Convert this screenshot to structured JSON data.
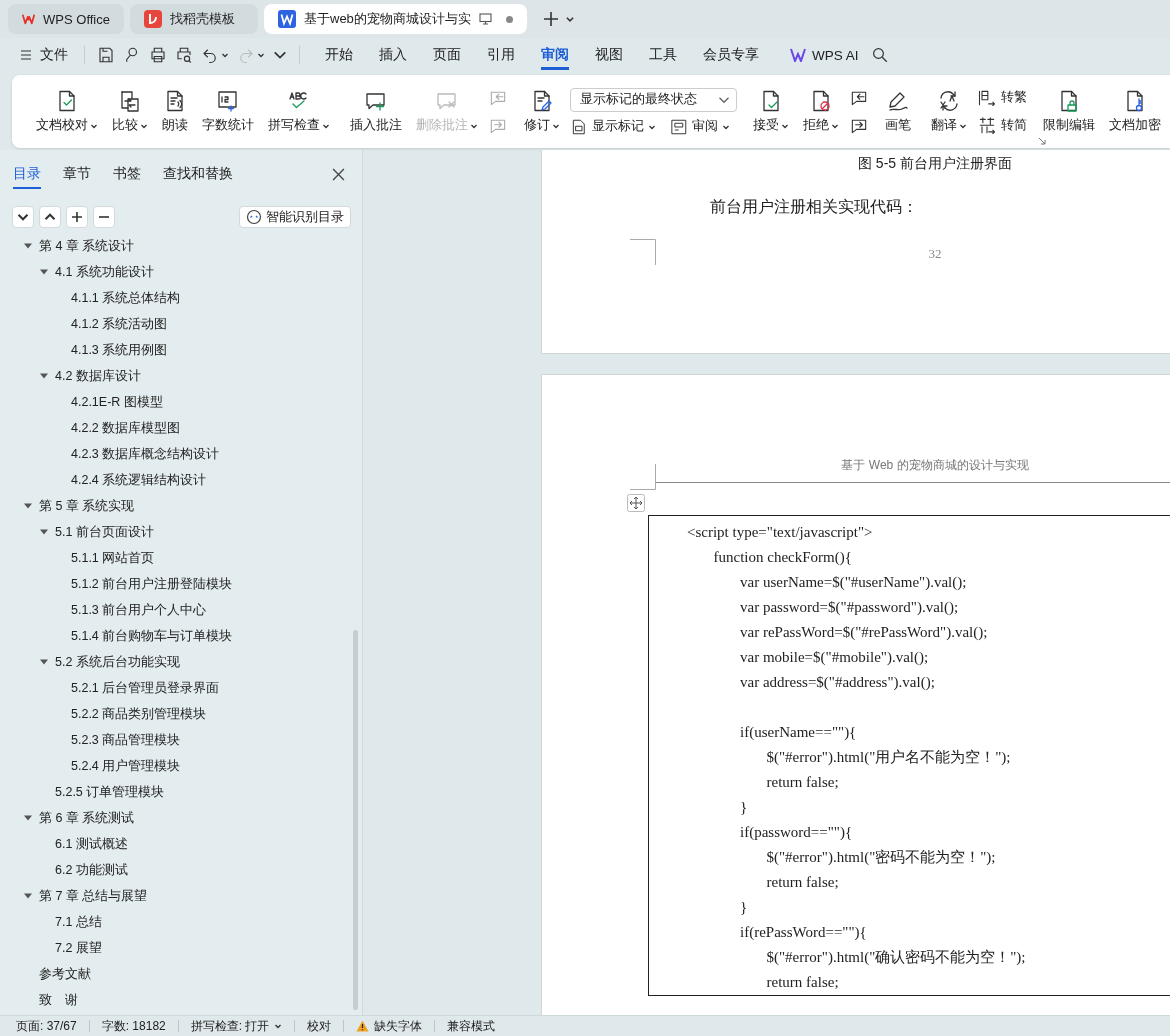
{
  "window_tabs": [
    {
      "label": "WPS Office",
      "kind": "home",
      "selected": false
    },
    {
      "label": "找稻壳模板",
      "kind": "template",
      "selected": false
    },
    {
      "label": "基于web的宠物商城设计与实",
      "kind": "document",
      "selected": true
    }
  ],
  "menu": {
    "file": "文件",
    "tabs": [
      {
        "label": "开始",
        "selected": false
      },
      {
        "label": "插入",
        "selected": false
      },
      {
        "label": "页面",
        "selected": false
      },
      {
        "label": "引用",
        "selected": false
      },
      {
        "label": "审阅",
        "selected": true
      },
      {
        "label": "视图",
        "selected": false
      },
      {
        "label": "工具",
        "selected": false
      },
      {
        "label": "会员专享",
        "selected": false
      }
    ],
    "ai": "WPS AI"
  },
  "ribbon": {
    "groups": [
      {
        "items": [
          {
            "kind": "large",
            "label": "文档校对",
            "dropdown": true,
            "disabled": false
          },
          {
            "kind": "large",
            "label": "比较",
            "dropdown": true,
            "disabled": false
          },
          {
            "kind": "large",
            "label": "朗读",
            "dropdown": false,
            "disabled": false
          },
          {
            "kind": "large",
            "label": "字数统计",
            "dropdown": false,
            "disabled": false
          },
          {
            "kind": "large",
            "label": "拼写检查",
            "dropdown": true,
            "disabled": false
          }
        ]
      },
      {
        "items": [
          {
            "kind": "large",
            "label": "插入批注",
            "dropdown": false,
            "disabled": false
          },
          {
            "kind": "large",
            "label": "删除批注",
            "dropdown": true,
            "disabled": true
          },
          {
            "kind": "pair",
            "disabled": true
          }
        ]
      },
      {
        "items": [
          {
            "kind": "large",
            "label": "修订",
            "dropdown": true,
            "disabled": false
          },
          {
            "kind": "select-stack",
            "select": {
              "value": "显示标记的最终状态"
            },
            "buttons": [
              {
                "label": "显示标记",
                "dropdown": true
              },
              {
                "label": "审阅",
                "dropdown": true
              }
            ]
          }
        ]
      },
      {
        "items": [
          {
            "kind": "large",
            "label": "接受",
            "dropdown": true,
            "disabled": false
          },
          {
            "kind": "large",
            "label": "拒绝",
            "dropdown": true,
            "disabled": false
          },
          {
            "kind": "pair",
            "disabled": false
          }
        ]
      },
      {
        "items": [
          {
            "kind": "large",
            "label": "画笔",
            "dropdown": false,
            "disabled": false
          }
        ]
      },
      {
        "items": [
          {
            "kind": "large",
            "label": "翻译",
            "dropdown": true,
            "disabled": false
          },
          {
            "kind": "small-stack",
            "buttons": [
              {
                "label": "转繁",
                "dropdown": false
              },
              {
                "label": "转简",
                "dropdown": false
              }
            ]
          }
        ]
      },
      {
        "items": [
          {
            "kind": "large",
            "label": "限制编辑",
            "dropdown": false,
            "disabled": false
          },
          {
            "kind": "large",
            "label": "文档加密",
            "dropdown": false,
            "disabled": false
          }
        ]
      }
    ]
  },
  "sidebar": {
    "tabs": [
      {
        "label": "目录",
        "selected": true
      },
      {
        "label": "章节",
        "selected": false
      },
      {
        "label": "书签",
        "selected": false
      },
      {
        "label": "查找和替换",
        "selected": false
      }
    ],
    "smart_button": "智能识别目录",
    "toc": {
      "items": [
        {
          "label": "第 4 章  系统设计",
          "expanded": true,
          "children": [
            {
              "label": "4.1  系统功能设计",
              "expanded": true,
              "children": [
                {
                  "label": "4.1.1 系统总体结构"
                },
                {
                  "label": "4.1.2 系统活动图"
                },
                {
                  "label": "4.1.3 系统用例图"
                }
              ]
            },
            {
              "label": "4.2 数据库设计",
              "expanded": true,
              "children": [
                {
                  "label": "4.2.1E-R 图模型"
                },
                {
                  "label": "4.2.2 数据库模型图"
                },
                {
                  "label": "4.2.3 数据库概念结构设计"
                },
                {
                  "label": "4.2.4 系统逻辑结构设计"
                }
              ]
            }
          ]
        },
        {
          "label": "第 5 章  系统实现",
          "expanded": true,
          "children": [
            {
              "label": "5.1 前台页面设计",
              "expanded": true,
              "children": [
                {
                  "label": "5.1.1 网站首页"
                },
                {
                  "label": "5.1.2 前台用户注册登陆模块"
                },
                {
                  "label": "5.1.3 前台用户个人中心"
                },
                {
                  "label": "5.1.4 前台购物车与订单模块"
                }
              ]
            },
            {
              "label": "5.2 系统后台功能实现",
              "expanded": true,
              "children": [
                {
                  "label": "5.2.1 后台管理员登录界面"
                },
                {
                  "label": "5.2.2 商品类别管理模块"
                },
                {
                  "label": "5.2.3 商品管理模块"
                },
                {
                  "label": "5.2.4 用户管理模块"
                }
              ]
            },
            {
              "label": "5.2.5 订单管理模块"
            }
          ]
        },
        {
          "label": "第 6 章  系统测试",
          "expanded": true,
          "children": [
            {
              "label": "6.1 测试概述"
            },
            {
              "label": "6.2 功能测试"
            }
          ]
        },
        {
          "label": "第 7 章  总结与展望",
          "expanded": true,
          "children": [
            {
              "label": "7.1 总结"
            },
            {
              "label": "7.2 展望"
            }
          ]
        },
        {
          "label": "参考文献"
        },
        {
          "label": "致　谢"
        }
      ]
    }
  },
  "document": {
    "page_1": {
      "caption": "图 5-5  前台用户注册界面",
      "paragraph": "前台用户注册相关实现代码：",
      "page_number": "32"
    },
    "page_2": {
      "header": "基于 Web 的宠物商城的设计与实现",
      "code": [
        {
          "line": "<script type=\"text/javascript\">",
          "children": [
            {
              "line": "function checkForm(){",
              "children": [
                {
                  "line": "var userName=$(\"#userName\").val();"
                },
                {
                  "line": "var password=$(\"#password\").val();"
                },
                {
                  "line": "var rePassWord=$(\"#rePassWord\").val();"
                },
                {
                  "line": "var mobile=$(\"#mobile\").val();"
                },
                {
                  "line": "var address=$(\"#address\").val();"
                },
                {
                  "line": "if(userName==\"\"){",
                  "blank_before": true,
                  "children": [
                    {
                      "line": "$(\"#error\").html(\"用户名不能为空！\");"
                    },
                    {
                      "line": "return false;"
                    }
                  ]
                },
                {
                  "line": "}"
                },
                {
                  "line": "if(password==\"\"){",
                  "children": [
                    {
                      "line": "$(\"#error\").html(\"密码不能为空！\");"
                    },
                    {
                      "line": "return false;"
                    }
                  ]
                },
                {
                  "line": "}"
                },
                {
                  "line": "if(rePassWord==\"\"){",
                  "children": [
                    {
                      "line": "$(\"#error\").html(\"确认密码不能为空！\");"
                    },
                    {
                      "line": "return false;"
                    }
                  ]
                }
              ]
            }
          ]
        }
      ]
    }
  },
  "status_bar": [
    {
      "label": "页面: 37/67",
      "dropdown": false,
      "warning": false
    },
    {
      "label": "字数: 18182",
      "dropdown": false,
      "warning": false
    },
    {
      "label": "拼写检查: 打开",
      "dropdown": true,
      "warning": false
    },
    {
      "label": "校对",
      "dropdown": false,
      "warning": false
    },
    {
      "label": "缺失字体",
      "dropdown": false,
      "warning": true
    },
    {
      "label": "兼容模式",
      "dropdown": false,
      "warning": false
    }
  ]
}
